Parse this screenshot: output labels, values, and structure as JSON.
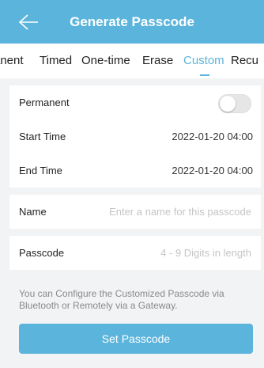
{
  "header": {
    "title": "Generate Passcode",
    "back_icon": "arrow-left-icon"
  },
  "tabs": [
    {
      "label": "anent"
    },
    {
      "label": "Timed"
    },
    {
      "label": "One-time"
    },
    {
      "label": "Erase"
    },
    {
      "label": "Custom",
      "active": true
    },
    {
      "label": "Recu"
    }
  ],
  "settings": {
    "permanent": {
      "label": "Permanent",
      "enabled": false
    },
    "start_time": {
      "label": "Start Time",
      "value": "2022-01-20 04:00"
    },
    "end_time": {
      "label": "End Time",
      "value": "2022-01-20 04:00"
    }
  },
  "name_field": {
    "label": "Name",
    "placeholder": "Enter a name for this passcode"
  },
  "passcode_field": {
    "label": "Passcode",
    "placeholder": "4 - 9 Digits in length"
  },
  "note": "You can Configure the Customized Passcode via Bluetooth or Remotely via a Gateway.",
  "set_button": {
    "label": "Set Passcode"
  },
  "colors": {
    "accent": "#5bb4dc",
    "background": "#f2f3f5"
  }
}
